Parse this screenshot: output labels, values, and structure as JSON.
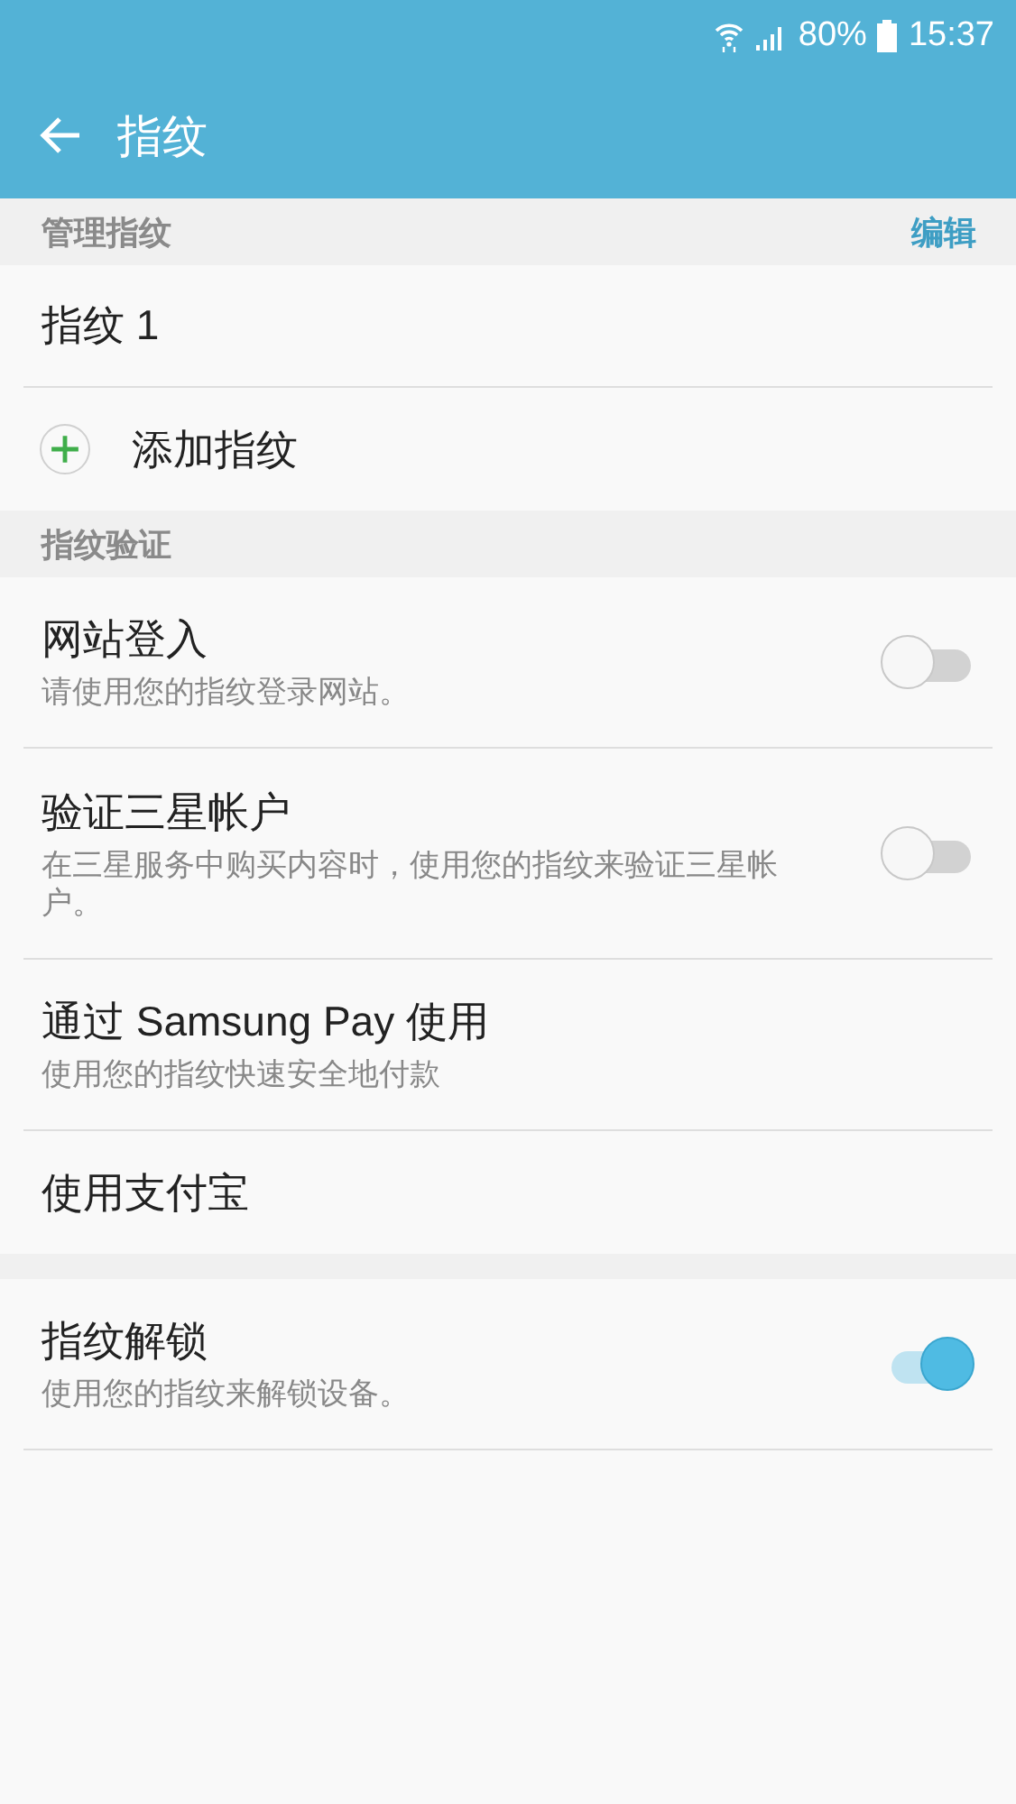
{
  "status_bar": {
    "battery": "80%",
    "time": "15:37"
  },
  "app_bar": {
    "title": "指纹"
  },
  "sections": [
    {
      "header": "管理指纹",
      "action": "编辑",
      "items": [
        {
          "kind": "entry",
          "title": "指纹 1"
        },
        {
          "kind": "add",
          "title": "添加指纹"
        }
      ]
    },
    {
      "header": "指纹验证",
      "items": [
        {
          "kind": "toggle",
          "title": "网站登入",
          "subtitle": "请使用您的指纹登录网站。",
          "on": false
        },
        {
          "kind": "toggle",
          "title": "验证三星帐户",
          "subtitle": "在三星服务中购买内容时，使用您的指纹来验证三星帐户。",
          "on": false
        },
        {
          "kind": "entry",
          "title": "通过 Samsung Pay 使用",
          "subtitle": "使用您的指纹快速安全地付款"
        },
        {
          "kind": "entry",
          "title": "使用支付宝"
        }
      ]
    },
    {
      "items": [
        {
          "kind": "toggle",
          "title": "指纹解锁",
          "subtitle": "使用您的指纹来解锁设备。",
          "on": true
        }
      ]
    }
  ]
}
